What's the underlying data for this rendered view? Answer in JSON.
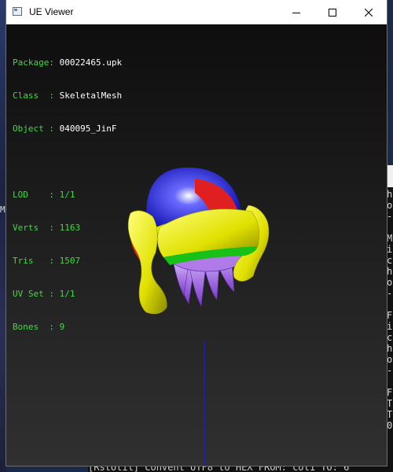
{
  "window": {
    "title": "UE Viewer"
  },
  "info": {
    "package": {
      "label": "Package: ",
      "value": "00022465.upk"
    },
    "class": {
      "label": "Class  : ",
      "value": "SkeletalMesh"
    },
    "object": {
      "label": "Object : ",
      "value": "040095_JinF"
    },
    "lod": {
      "label": "LOD    : ",
      "value": "1/1"
    },
    "verts": {
      "label": "Verts  : ",
      "value": "1163"
    },
    "tris": {
      "label": "Tris   : ",
      "value": "1507"
    },
    "uvset": {
      "label": "UV Set : ",
      "value": "1/1"
    },
    "bones": {
      "label": "Bones  : ",
      "value": "9"
    }
  },
  "background": {
    "left_char": "M",
    "right_lines": "h\no\n-\n\nM\ni\nc\nh\no\n-\n\nF\ni\nc\nh\no\n-\n\nF\nT\nT\n0",
    "bottom_text": "[RstUtil] Convent UTF8 to HEX  FROM: col1  TO: 6"
  },
  "icons": {
    "app": "app-window-icon",
    "minimize": "minimize-icon",
    "maximize": "maximize-icon",
    "close": "close-icon"
  }
}
